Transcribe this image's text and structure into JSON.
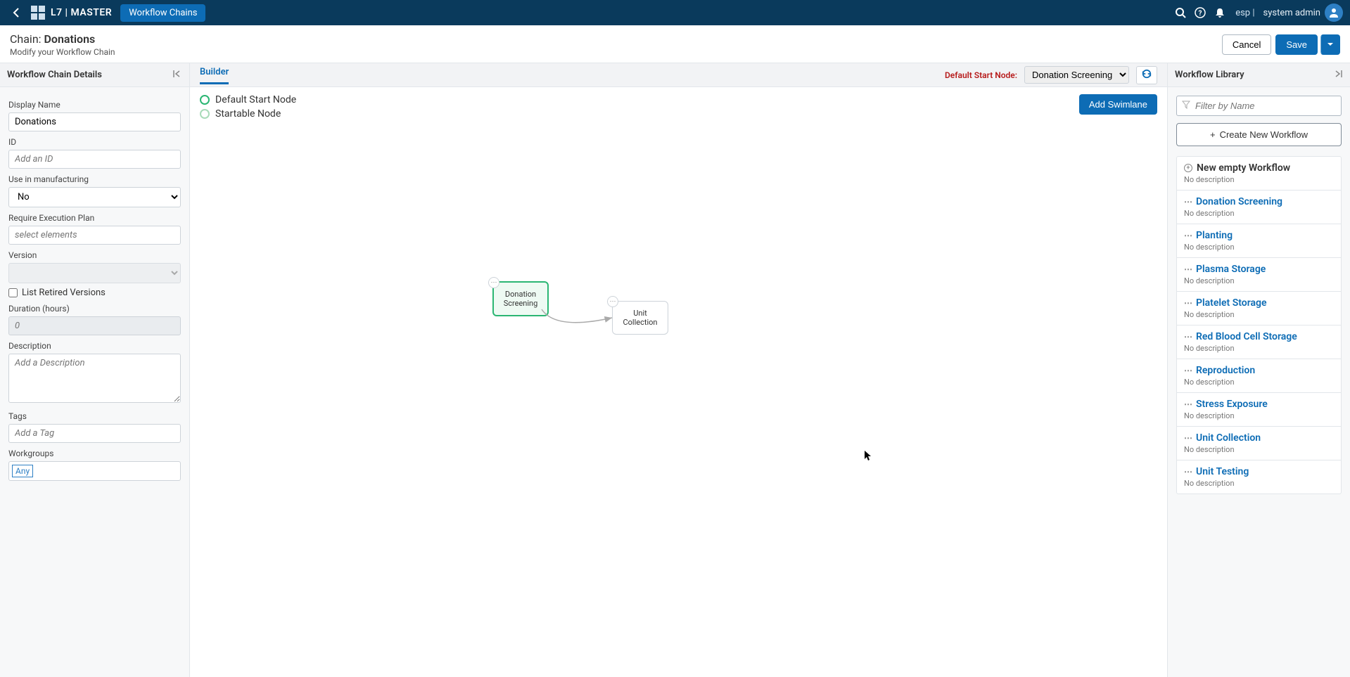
{
  "topbar": {
    "brand": "L7 | MASTER",
    "pill": "Workflow Chains",
    "lang": "esp",
    "user": "system admin"
  },
  "subheader": {
    "prefix": "Chain:",
    "name": "Donations",
    "subtitle": "Modify your Workflow Chain",
    "cancel": "Cancel",
    "save": "Save"
  },
  "leftPanel": {
    "title": "Workflow Chain Details",
    "displayName_label": "Display Name",
    "displayName_value": "Donations",
    "id_label": "ID",
    "id_placeholder": "Add an ID",
    "useManuf_label": "Use in manufacturing",
    "useManuf_value": "No",
    "reqExec_label": "Require Execution Plan",
    "reqExec_placeholder": "select elements",
    "version_label": "Version",
    "listRetired_label": "List Retired Versions",
    "duration_label": "Duration (hours)",
    "duration_placeholder": "0",
    "desc_label": "Description",
    "desc_placeholder": "Add a Description",
    "tags_label": "Tags",
    "tags_placeholder": "Add a Tag",
    "workgroups_label": "Workgroups",
    "workgroups_tag": "Any"
  },
  "centerPanel": {
    "tab": "Builder",
    "startLabel": "Default Start Node:",
    "startSelect": "Donation Screening",
    "legend_default": "Default Start Node",
    "legend_startable": "Startable Node",
    "addSwimlane": "Add Swimlane",
    "node1": "Donation Screening",
    "node2": "Unit Collection"
  },
  "rightPanel": {
    "title": "Workflow Library",
    "filter_placeholder": "Filter by Name",
    "create": "Create New Workflow",
    "newEmpty": "New empty Workflow",
    "noDesc": "No description",
    "items": [
      "Donation Screening",
      "Planting",
      "Plasma Storage",
      "Platelet Storage",
      "Red Blood Cell Storage",
      "Reproduction",
      "Stress Exposure",
      "Unit Collection",
      "Unit Testing"
    ]
  }
}
